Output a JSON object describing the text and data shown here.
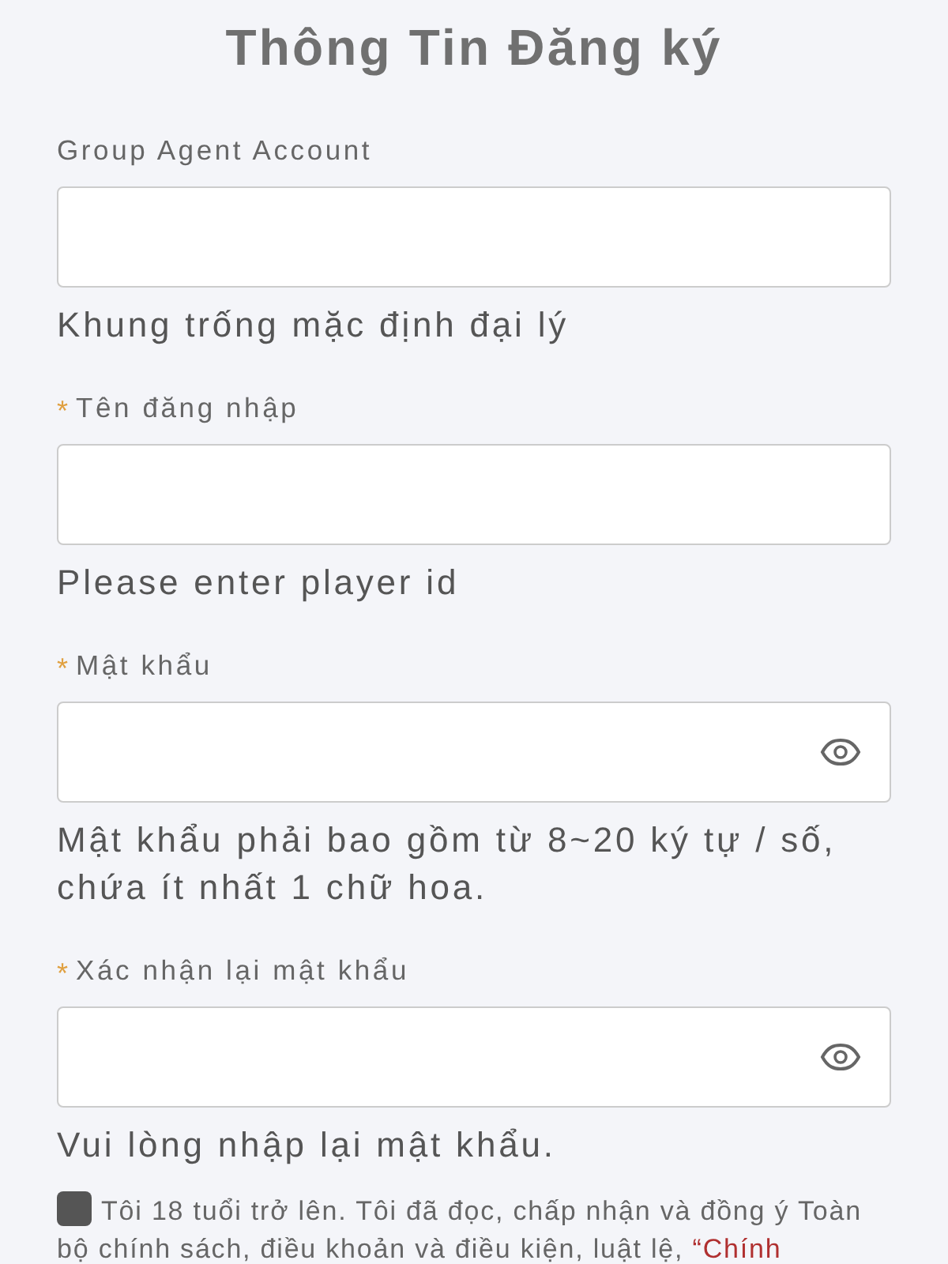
{
  "title": "Thông Tin Đăng ký",
  "fields": [
    {
      "label": "Group Agent Account",
      "kind": "text",
      "helper": "Khung trống mặc định đại lý"
    },
    {
      "required_mark": "*",
      "label": "Tên đăng nhập",
      "kind": "text",
      "helper": "Please enter player id"
    },
    {
      "required_mark": "*",
      "label": "Mật khẩu",
      "kind": "password",
      "helper": "Mật khẩu phải bao gồm từ 8~20 ký tự / số, chứa ít nhất 1 chữ hoa."
    },
    {
      "required_mark": "*",
      "label": "Xác nhận lại mật khẩu",
      "kind": "password",
      "helper": "Vui lòng nhập lại mật khẩu."
    }
  ],
  "agreement": {
    "checked": false,
    "text": "Tôi 18 tuổi trở lên. Tôi đã đọc, chấp nhận và đồng ý Toàn bộ chính sách, điều khoản và điều kiện, luật lệ, ",
    "link": "“Chính"
  }
}
